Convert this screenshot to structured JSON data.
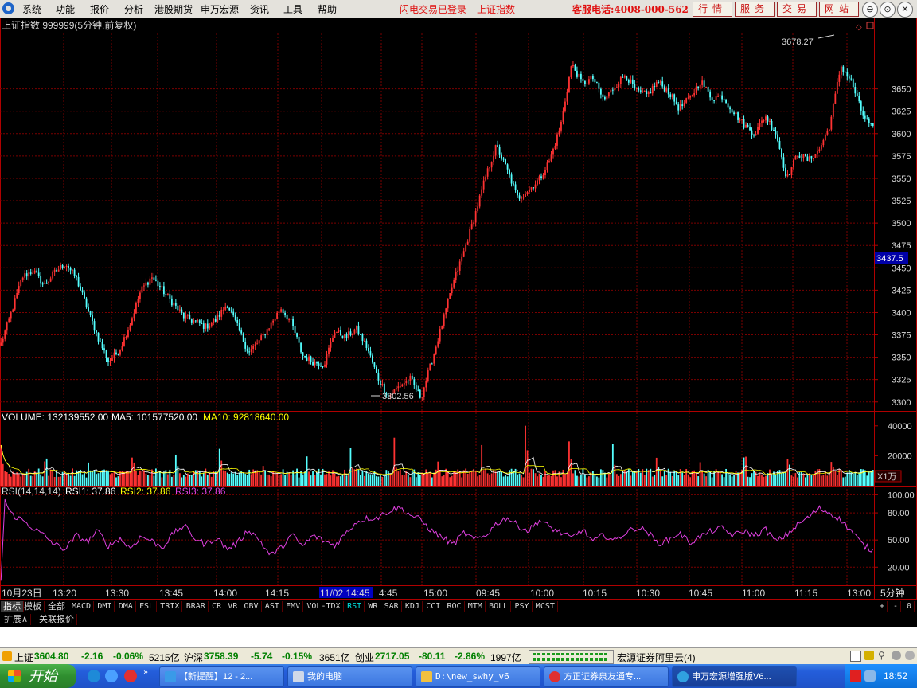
{
  "menu": {
    "items": [
      "系统",
      "功能",
      "报价",
      "分析",
      "港股期货",
      "申万宏源",
      "资讯",
      "工具",
      "帮助"
    ],
    "notice1": "闪电交易已登录",
    "notice2": "上证指数",
    "hotline": "客服电话:4008-000-562",
    "buttons": [
      "行情",
      "服务",
      "交易",
      "网站"
    ],
    "window_buttons": [
      "⊖",
      "⊙",
      "✕"
    ]
  },
  "colors": {
    "up": "#ff3232",
    "down": "#54ffff",
    "ma5": "#ffffff",
    "ma10": "#ffff00",
    "rsi": "#e040e0",
    "grid": "#7a0000",
    "axis": "#b00000"
  },
  "chart_data": {
    "type": "candlestick",
    "main": {
      "title": "上证指数 999999(5分钟,前复权)",
      "ylim": [
        3290,
        3712
      ],
      "yticks": [
        3300,
        3325,
        3350,
        3375,
        3400,
        3425,
        3450,
        3475,
        3500,
        3525,
        3550,
        3575,
        3600,
        3625,
        3650
      ],
      "current_price_label": "3437.5",
      "annotations": [
        {
          "label": "3302.56",
          "value": 3302.56
        },
        {
          "label": "3678.27",
          "value": 3678.27
        }
      ],
      "close_path": [
        3365,
        3402,
        3440,
        3447,
        3430,
        3445,
        3455,
        3438,
        3405,
        3372,
        3345,
        3358,
        3388,
        3425,
        3440,
        3425,
        3410,
        3395,
        3390,
        3384,
        3392,
        3410,
        3383,
        3355,
        3368,
        3386,
        3405,
        3388,
        3352,
        3345,
        3342,
        3380,
        3372,
        3382,
        3361,
        3327,
        3306,
        3318,
        3326,
        3305,
        3345,
        3388,
        3433,
        3468,
        3508,
        3551,
        3586,
        3560,
        3528,
        3537,
        3549,
        3571,
        3610,
        3678,
        3656,
        3662,
        3637,
        3653,
        3666,
        3647,
        3643,
        3658,
        3647,
        3628,
        3640,
        3659,
        3640,
        3642,
        3625,
        3610,
        3600,
        3620,
        3600,
        3550,
        3578,
        3570,
        3582,
        3610,
        3676,
        3658,
        3622,
        3605
      ]
    },
    "volume": {
      "label": "VOLUME: 132139552.00",
      "ma5_label": "MA5: 101577520.00",
      "ma10_label": "MA10: 92818640.00",
      "ylim": [
        0,
        50000
      ],
      "yticks": [
        20000,
        40000
      ],
      "unit_label": "X1万",
      "peaks": [
        42000,
        30000,
        25000,
        28000,
        24000,
        27000,
        26000,
        24000,
        38000,
        34000,
        30000,
        29000,
        45000,
        33000,
        30000,
        27000,
        24000,
        36000,
        30000,
        20000
      ]
    },
    "rsi": {
      "label": "RSI(14,14,14)",
      "rsi1_label": "RSI1: 37.86",
      "rsi2_label": "RSI2: 37.86",
      "rsi3_label": "RSI3: 37.86",
      "ylim": [
        0,
        110
      ],
      "yticks": [
        20,
        50,
        80,
        100
      ],
      "tick_labels": [
        "20.00",
        "50.00",
        "80.00",
        "100.00"
      ],
      "path": [
        100,
        78,
        72,
        63,
        55,
        45,
        40,
        55,
        48,
        60,
        43,
        52,
        41,
        54,
        49,
        42,
        57,
        66,
        52,
        45,
        53,
        40,
        47,
        62,
        50,
        33,
        41,
        56,
        43,
        55,
        49,
        44,
        57,
        70,
        74,
        75,
        82,
        86,
        78,
        72,
        60,
        53,
        45,
        58,
        50,
        55,
        68,
        75,
        66,
        60,
        72,
        64,
        58,
        52,
        62,
        48,
        56,
        49,
        58,
        64,
        60,
        46,
        50,
        58,
        47,
        54,
        60,
        63,
        55,
        60,
        55,
        62,
        48,
        56,
        67,
        75,
        85,
        80,
        72,
        60,
        45,
        38
      ]
    },
    "xaxis": {
      "tick_labels": [
        "10月23日",
        "13:20",
        "13:30",
        "13:45",
        "14:00",
        "14:15",
        "11/02 14:45",
        "4:45",
        "15:00",
        "09:45",
        "10:00",
        "10:15",
        "10:30",
        "10:45",
        "11:00",
        "11:15",
        "13:00"
      ],
      "period_label": "5分钟"
    }
  },
  "indicator_tabs": [
    "指标",
    "模板",
    "全部",
    "MACD",
    "DMI",
    "DMA",
    "FSL",
    "TRIX",
    "BRAR",
    "CR",
    "VR",
    "OBV",
    "ASI",
    "EMV",
    "VOL-TDX",
    "RSI",
    "WR",
    "SAR",
    "KDJ",
    "CCI",
    "ROC",
    "MTM",
    "BOLL",
    "PSY",
    "MCST"
  ],
  "tab_controls": [
    "+",
    "-",
    "0"
  ],
  "row2_tabs": [
    "扩展∧",
    "关联报价"
  ],
  "status": {
    "sh_label": "上证",
    "sh_value": "3604.80",
    "sh_change": "-2.16",
    "sh_pct": "-0.06%",
    "sh_amount": "5215亿",
    "hs_label": "沪深",
    "hs_value": "3758.39",
    "hs_change": "-5.74",
    "hs_pct": "-0.15%",
    "hs_amount": "3651亿",
    "cy_label": "创业",
    "cy_value": "2717.05",
    "cy_change": "-80.11",
    "cy_pct": "-2.86%",
    "cy_amount": "1997亿",
    "broker": "宏源证券阿里云(4)"
  },
  "taskbar": {
    "start": "开始",
    "items": [
      "【新提醒】12 - 2...",
      "我的电脑",
      "D:\\new_swhy_v6",
      "方正证券泉友通专...",
      "申万宏源增强版V6..."
    ],
    "clock": "18:52"
  }
}
